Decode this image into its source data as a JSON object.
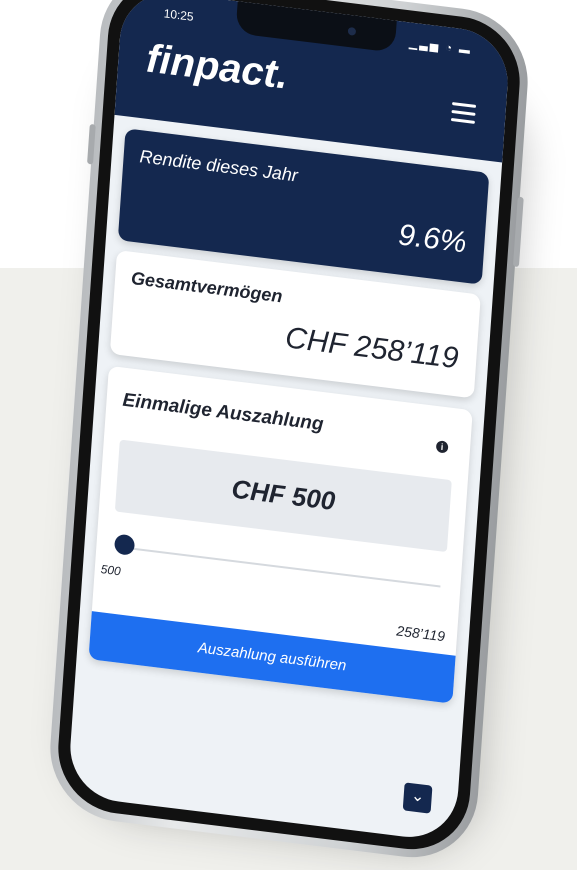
{
  "status_bar": {
    "time": "10:25",
    "icons": "▁▃▅ ◔ ▬"
  },
  "header": {
    "logo": "finpact.",
    "menu_icon": "hamburger-menu-icon"
  },
  "return_card": {
    "label": "Rendite dieses Jahr",
    "value": "9.6%"
  },
  "wealth_card": {
    "label": "Gesamtvermögen",
    "value": "CHF 258’119"
  },
  "payout_card": {
    "label": "Einmalige Auszahlung",
    "info_icon": "i",
    "amount": "CHF 500",
    "slider": {
      "min_label": "500",
      "max_label": "258’119",
      "value": 500
    },
    "button_label": "Auszahlung ausführen"
  },
  "scroll_button": {
    "icon": "chevron-down-icon",
    "glyph": "⌄"
  },
  "colors": {
    "navy": "#14284f",
    "accent_blue": "#1e6ff0",
    "background": "#eef2f6"
  }
}
